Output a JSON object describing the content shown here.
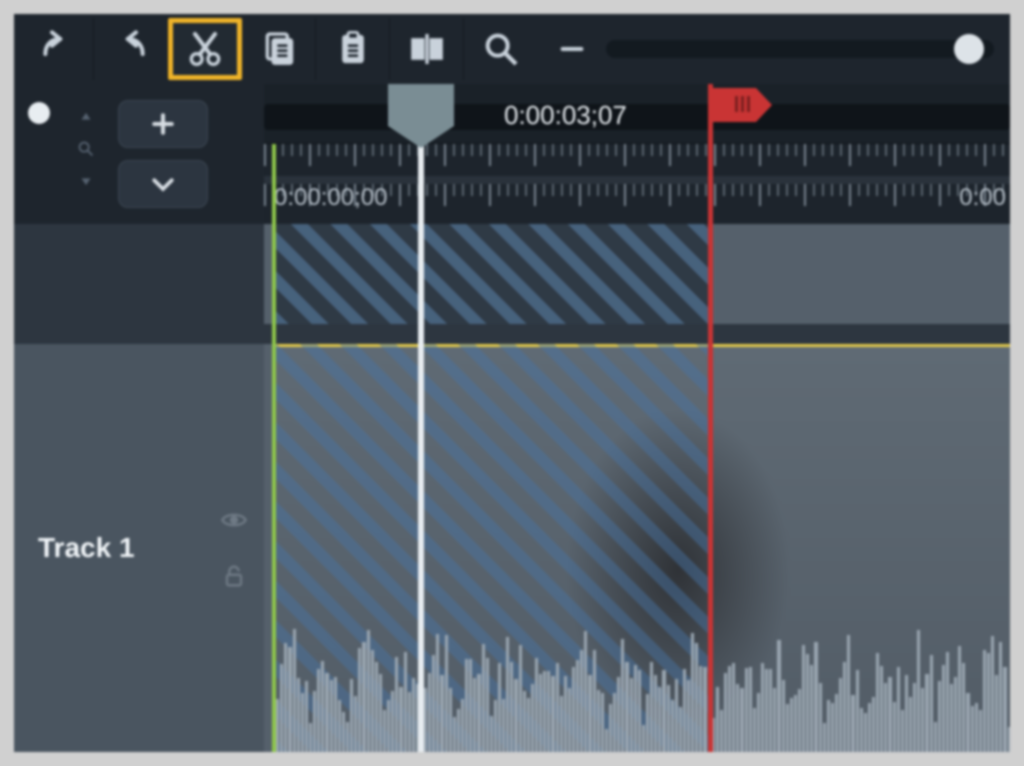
{
  "toolbar": {
    "undo": "Undo",
    "redo": "Redo",
    "cut": "Cut",
    "copy": "Copy",
    "paste": "Paste",
    "split": "Split",
    "zoom": "Zoom",
    "zoom_out": "Zoom Out"
  },
  "sidebar": {
    "add_label": "+",
    "expand_label": "▼"
  },
  "timeline": {
    "playhead_time": "0:00:03;07",
    "ruler_start": "0:00:00;00",
    "ruler_next": "0:00",
    "selection_start": "0:00:00;00",
    "selection_end_marker": "red",
    "zoom_slider_value": 0.92
  },
  "tracks": [
    {
      "name": "Track 1",
      "visible": true,
      "locked": false,
      "has_selection": true
    }
  ],
  "colors": {
    "highlight": "#f0b429",
    "marker_green": "#8fc74a",
    "marker_red": "#c93434",
    "playhead": "#e8edf1",
    "selection_overlay": "#4a75a8"
  }
}
